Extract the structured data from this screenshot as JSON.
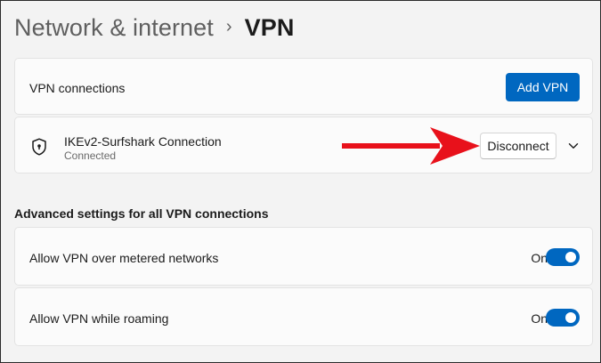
{
  "breadcrumb": {
    "parent": "Network & internet",
    "separator": "›",
    "current": "VPN"
  },
  "vpn_connections": {
    "label": "VPN connections",
    "add_button": "Add VPN"
  },
  "connection": {
    "name": "IKEv2-Surfshark Connection",
    "status": "Connected",
    "disconnect_button": "Disconnect"
  },
  "advanced": {
    "heading": "Advanced settings for all VPN connections",
    "settings": [
      {
        "label": "Allow VPN over metered networks",
        "state": "On"
      },
      {
        "label": "Allow VPN while roaming",
        "state": "On"
      }
    ]
  },
  "colors": {
    "accent": "#0067c0",
    "annotation_arrow": "#e8111b"
  },
  "icons": {
    "connection": "shield-icon",
    "expand": "chevron-down-icon"
  }
}
